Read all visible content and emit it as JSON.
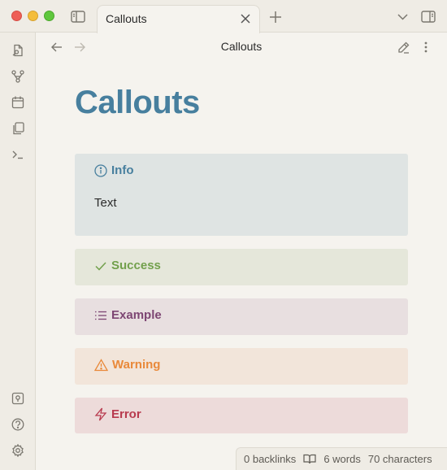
{
  "window": {
    "tab_title": "Callouts"
  },
  "header": {
    "title": "Callouts"
  },
  "note": {
    "title": "Callouts",
    "callouts": [
      {
        "type": "info",
        "label": "Info",
        "body": "Text",
        "icon": "info-icon",
        "color": "#477f9e"
      },
      {
        "type": "success",
        "label": "Success",
        "icon": "check-icon",
        "color": "#72a04c"
      },
      {
        "type": "example",
        "label": "Example",
        "icon": "list-icon",
        "color": "#7d4673"
      },
      {
        "type": "warning",
        "label": "Warning",
        "icon": "warning-triangle-icon",
        "color": "#e9893a"
      },
      {
        "type": "error",
        "label": "Error",
        "icon": "lightning-icon",
        "color": "#b83a4e"
      }
    ]
  },
  "status": {
    "backlinks": "0 backlinks",
    "words": "6 words",
    "characters": "70 characters"
  }
}
